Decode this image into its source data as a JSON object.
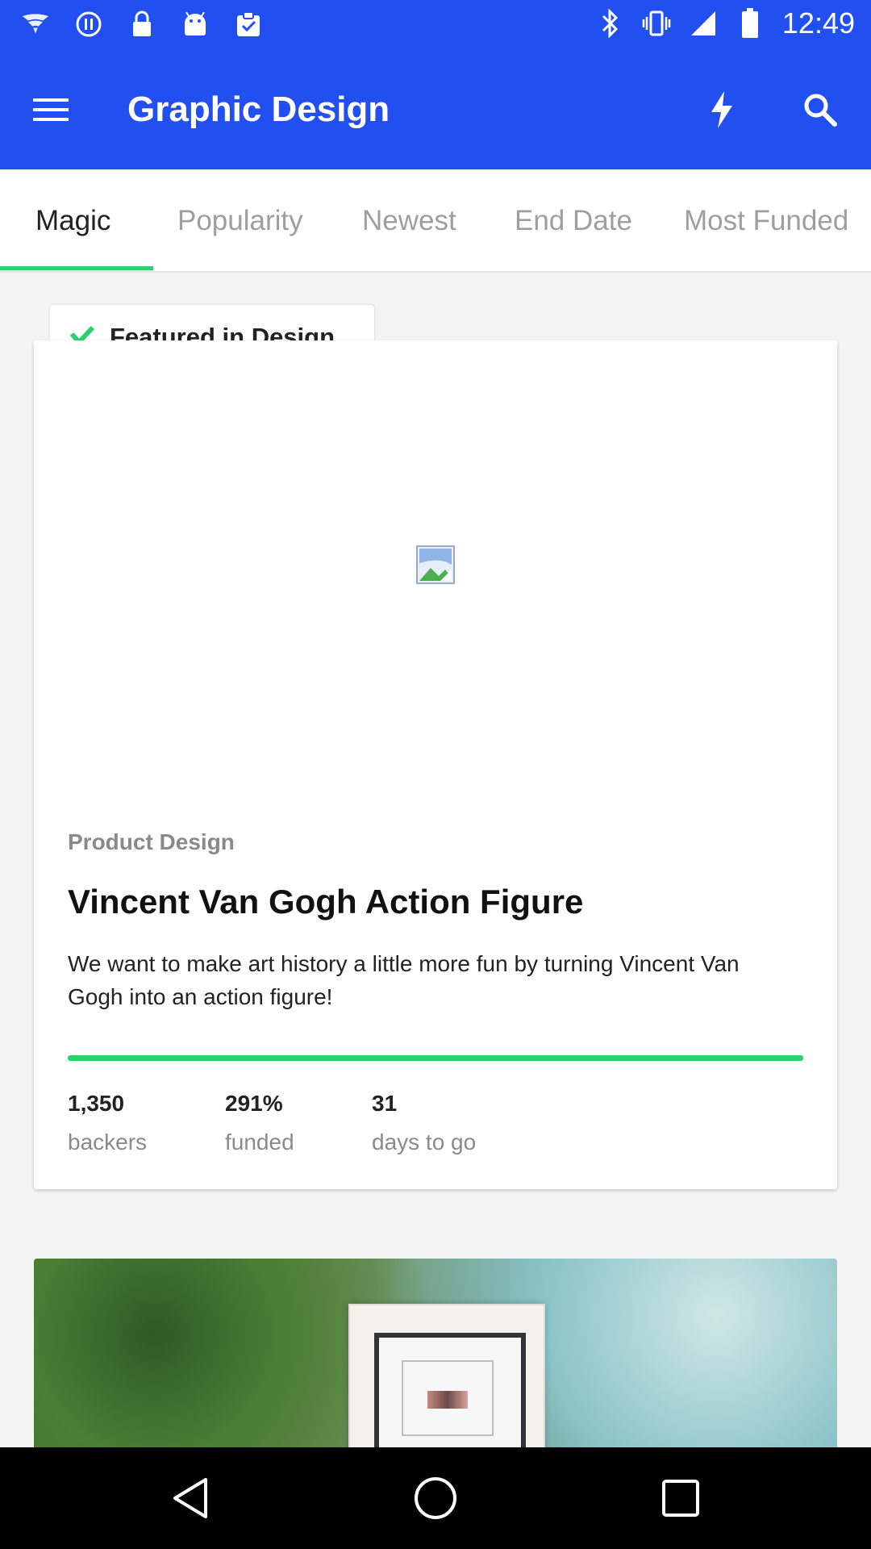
{
  "status_bar": {
    "time": "12:49",
    "left_icons": [
      "wifi-fan-icon",
      "circle-pause-icon",
      "lock-icon",
      "android-icon",
      "clipboard-check-icon"
    ],
    "right_icons": [
      "bluetooth-icon",
      "vibrate-icon",
      "signal-icon",
      "battery-icon"
    ]
  },
  "toolbar": {
    "title": "Graphic Design",
    "menu_icon": "menu-icon",
    "bolt_icon": "bolt-icon",
    "search_icon": "search-icon",
    "color": "#2250f0"
  },
  "tabs": [
    {
      "label": "Magic",
      "active": true
    },
    {
      "label": "Popularity",
      "active": false
    },
    {
      "label": "Newest",
      "active": false
    },
    {
      "label": "End Date",
      "active": false
    },
    {
      "label": "Most Funded",
      "active": false
    }
  ],
  "featured": {
    "label": "Featured in Design"
  },
  "project": {
    "category": "Product Design",
    "title": "Vincent Van Gogh Action Figure",
    "blurb": "We want to make art history a little more fun by turning Vincent Van Gogh into an action figure!",
    "progress_percent": 100,
    "stats": [
      {
        "value": "1,350",
        "label": "backers"
      },
      {
        "value": "291%",
        "label": "funded"
      },
      {
        "value": "31",
        "label": "days to go"
      }
    ]
  },
  "colors": {
    "accent": "#2bd16a",
    "primary": "#2250f0"
  },
  "nav": {
    "back_icon": "back-triangle-icon",
    "home_icon": "home-circle-icon",
    "recents_icon": "recents-square-icon"
  }
}
